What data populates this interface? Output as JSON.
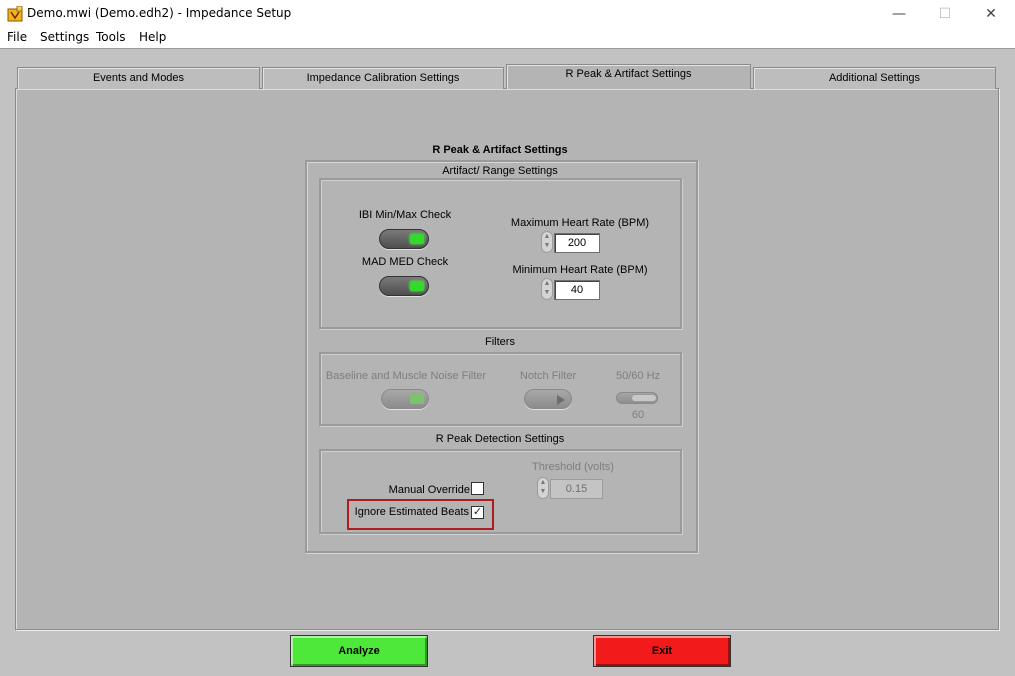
{
  "window": {
    "title": "Demo.mwi (Demo.edh2) - Impedance Setup",
    "controls": {
      "minimize": "—",
      "maximize": "☐",
      "close": "✕"
    },
    "app_icon": "labview-app-icon"
  },
  "menu": [
    "File",
    "Settings",
    "Tools",
    "Help"
  ],
  "tabs": [
    {
      "label": "Events and Modes",
      "active": false
    },
    {
      "label": "Impedance Calibration Settings",
      "active": false
    },
    {
      "label": "R Peak & Artifact Settings",
      "active": true
    },
    {
      "label": "Additional Settings",
      "active": false
    }
  ],
  "panel": {
    "title": "R Peak & Artifact Settings",
    "artifact": {
      "title": "Artifact/ Range Settings",
      "ibi_label": "IBI Min/Max Check",
      "mad_label": "MAD MED Check",
      "max_hr_label": "Maximum Heart Rate (BPM)",
      "max_hr_value": "200",
      "min_hr_label": "Minimum Heart Rate (BPM)",
      "min_hr_value": "40"
    },
    "filters": {
      "title": "Filters",
      "baseline_label": "Baseline and Muscle Noise Filter",
      "notch_label": "Notch Filter",
      "hz_label": "50/60 Hz",
      "hz_value": "60"
    },
    "rpeak": {
      "title": "R Peak Detection Settings",
      "threshold_label": "Threshold (volts)",
      "threshold_value": "0.15",
      "manual_override_label": "Manual Override",
      "manual_override_checked": false,
      "ignore_beats_label": "Ignore Estimated Beats",
      "ignore_beats_checked": true,
      "check_glyph": "✓"
    }
  },
  "buttons": {
    "analyze": "Analyze",
    "exit": "Exit"
  },
  "colors": {
    "analyze": "#4ee83a",
    "exit": "#f21a1a",
    "panel": "#b4b4b4",
    "highlight": "#b01c1c"
  }
}
